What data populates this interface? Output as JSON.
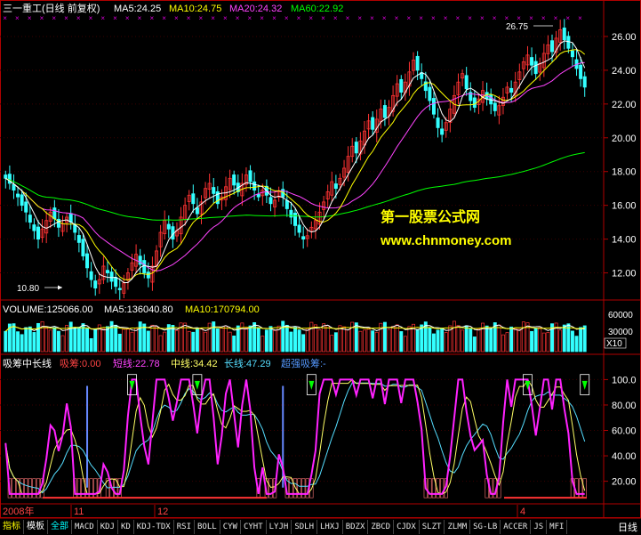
{
  "header": {
    "main_title": "三一重工(日线 前复权)",
    "ma5": "MA5:24.25",
    "ma10": "MA10:24.75",
    "ma20": "MA20:24.32",
    "ma60": "MA60:22.92"
  },
  "annotations": {
    "high": "26.75",
    "low": "10.80"
  },
  "watermark": {
    "line1": "第一股票公式网",
    "line2": "www.chnmoney.com"
  },
  "volume_header": {
    "volume": "VOLUME:125066.00",
    "ma5": "MA5:136040.80",
    "ma10": "MA10:170794.00"
  },
  "indicator_header": {
    "name": "吸筹中长线",
    "xichou": "吸筹:0.00",
    "short": "短线:22.78",
    "mid": "中线:34.42",
    "long": "长线:47.29",
    "super": "超强吸筹:-"
  },
  "axis_labels": {
    "year": "2008年",
    "m11": "11",
    "m12": "12",
    "m4": "4",
    "vol_unit": "X10"
  },
  "bottom_bar": {
    "tabs": [
      "指标",
      "模板",
      "全部"
    ],
    "indicators": [
      "MACD",
      "KDJ",
      "KD",
      "KDJ-TDX",
      "RSI",
      "BOLL",
      "CYW",
      "CYHT",
      "LYJH",
      "SDLH",
      "LHXJ",
      "BDZX",
      "ZBCD",
      "CJDX",
      "SLZT",
      "ZLMM",
      "SG-LB",
      "ACCER",
      "JS",
      "MFI"
    ],
    "period": "日线"
  },
  "colors": {
    "up": "#ff3333",
    "down": "#33ffff",
    "ma5": "#ffffff",
    "ma10": "#ffff00",
    "ma20": "#ff44ff",
    "ma60": "#00ff00",
    "frame": "#b00000",
    "short": "#ff22ff",
    "mid": "#ffff66",
    "long": "#55ddff"
  },
  "chart_data": [
    {
      "type": "candlestick",
      "title": "三一重工(日线 前复权)",
      "ylim": [
        10.5,
        27
      ],
      "y_ticks": [
        12,
        14,
        16,
        18,
        20,
        22,
        24,
        26
      ],
      "y_tick_labels": [
        "12.00",
        "14.00",
        "16.00",
        "18.00",
        "20.00",
        "22.00",
        "24.00",
        "26.00"
      ],
      "x_labels": [
        "2008年",
        "11",
        "12",
        "4"
      ],
      "close": [
        17.6,
        17.3,
        16.9,
        16.5,
        16.0,
        15.6,
        15.0,
        14.5,
        14.0,
        14.6,
        15.1,
        15.6,
        15.2,
        14.7,
        14.9,
        15.3,
        15.0,
        14.4,
        13.8,
        13.0,
        12.3,
        11.6,
        11.1,
        11.6,
        12.4,
        12.0,
        11.5,
        11.2,
        11.0,
        11.4,
        12.0,
        12.6,
        13.1,
        12.5,
        12.0,
        11.7,
        12.4,
        13.3,
        14.4,
        15.1,
        14.6,
        14.0,
        14.5,
        15.3,
        16.0,
        16.6,
        16.1,
        15.5,
        16.2,
        17.0,
        17.3,
        16.7,
        16.1,
        16.5,
        17.1,
        17.6,
        17.2,
        16.8,
        17.3,
        17.8,
        17.4,
        16.9,
        16.5,
        16.9,
        16.6,
        16.1,
        16.3,
        16.8,
        16.5,
        15.8,
        15.3,
        14.8,
        14.4,
        14.0,
        14.2,
        14.7,
        15.1,
        15.6,
        16.2,
        16.8,
        17.4,
        17.0,
        17.6,
        18.2,
        18.9,
        19.5,
        19.1,
        19.8,
        20.4,
        21.0,
        20.5,
        21.1,
        21.7,
        21.2,
        21.8,
        22.5,
        23.2,
        22.7,
        23.3,
        23.9,
        24.6,
        24.0,
        23.5,
        22.8,
        22.2,
        21.4,
        20.6,
        20.2,
        20.9,
        21.7,
        22.5,
        23.3,
        23.8,
        22.9,
        22.2,
        21.8,
        22.3,
        22.8,
        22.3,
        22.0,
        21.6,
        21.9,
        22.4,
        23.0,
        22.7,
        23.3,
        23.9,
        24.5,
        24.9,
        24.3,
        23.8,
        24.4,
        25.0,
        25.5,
        25.1,
        25.9,
        26.4,
        25.8,
        25.3,
        24.8,
        24.1,
        23.5,
        23.0
      ],
      "ma5": [
        24.25
      ],
      "ma10": [
        24.75
      ],
      "ma20": [
        24.32
      ],
      "ma60": [
        22.92
      ],
      "annotations": [
        {
          "label": "26.75",
          "type": "high"
        },
        {
          "label": "10.80",
          "type": "low"
        }
      ]
    },
    {
      "type": "bar",
      "title": "VOLUME",
      "y_tick_labels": [
        "60000",
        "30000"
      ],
      "unit": "X10",
      "last_volume": 125066.0,
      "ma5": 136040.8,
      "ma10": 170794.0
    },
    {
      "type": "line",
      "title": "吸筹中长线",
      "ylim": [
        5,
        108
      ],
      "y_ticks": [
        20,
        40,
        60,
        80,
        100
      ],
      "y_tick_labels": [
        "20.00",
        "40.00",
        "60.00",
        "80.00",
        "100.0"
      ],
      "series": [
        {
          "name": "短线",
          "last": 22.78
        },
        {
          "name": "中线",
          "last": 34.42
        },
        {
          "name": "长线",
          "last": 47.29
        }
      ],
      "xichou_last": 0.0
    }
  ]
}
